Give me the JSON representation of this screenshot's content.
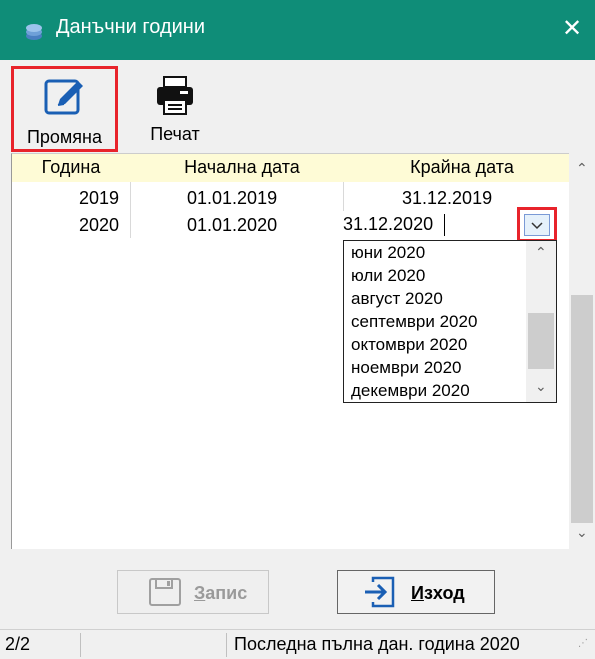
{
  "window": {
    "title": "Данъчни години"
  },
  "toolbar": {
    "edit_label": "Промяна",
    "print_label": "Печат"
  },
  "grid": {
    "headers": [
      "Година",
      "Начална дата",
      "Крайна дата"
    ],
    "rows": [
      {
        "year": "2019",
        "start": "01.01.2019",
        "end": "31.12.2019"
      },
      {
        "year": "2020",
        "start": "01.01.2020",
        "end": "31.12.2020"
      }
    ]
  },
  "dropdown": {
    "items": [
      "юни 2020",
      "юли 2020",
      "август 2020",
      "септември 2020",
      "октомври 2020",
      "ноември 2020",
      "декември 2020"
    ]
  },
  "buttons": {
    "save": {
      "underline": "З",
      "rest": "апис"
    },
    "exit": {
      "underline": "И",
      "rest": "зход"
    }
  },
  "status": {
    "record": "2/2",
    "message": "Последна пълна дан. година 2020"
  },
  "colors": {
    "titlebar": "#0f8d78",
    "highlight": "#e8232b",
    "header_bg": "#fefbd6",
    "icon_blue": "#1a5fb4"
  }
}
